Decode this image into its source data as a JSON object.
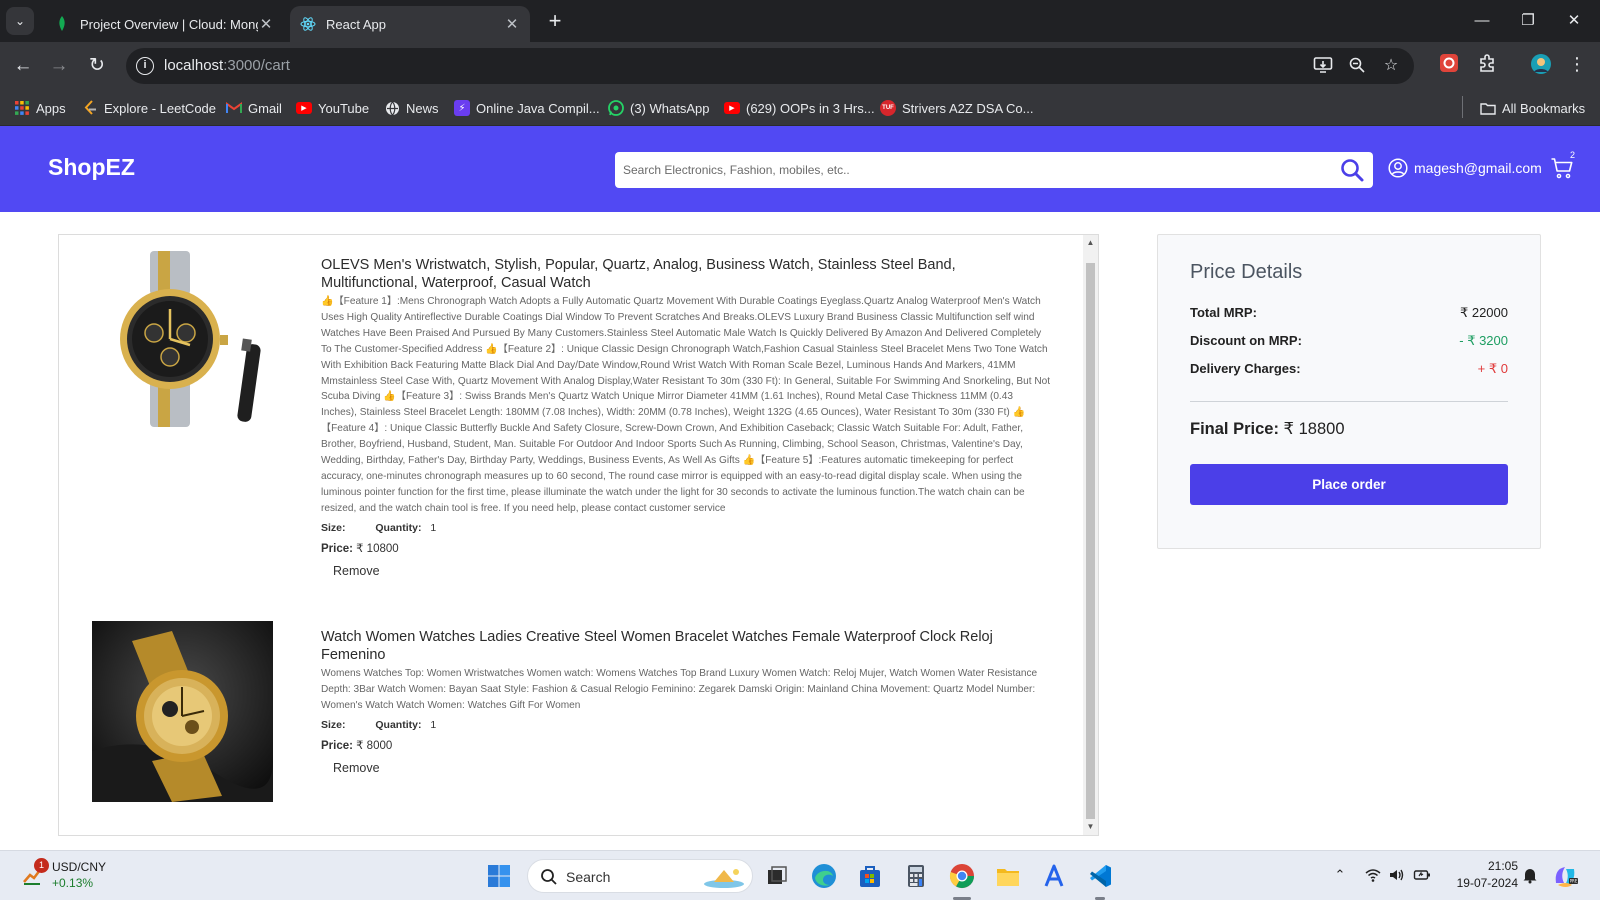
{
  "browser": {
    "tabs": [
      {
        "title": "Project Overview | Cloud: Mong",
        "active": false
      },
      {
        "title": "React App",
        "active": true
      }
    ],
    "url_host": "localhost",
    "url_path": ":3000/cart",
    "bookmarks": [
      {
        "label": "Apps",
        "icon": "apps-grid-icon"
      },
      {
        "label": "Explore - LeetCode",
        "icon": "leetcode-icon"
      },
      {
        "label": "Gmail",
        "icon": "gmail-icon"
      },
      {
        "label": "YouTube",
        "icon": "youtube-icon"
      },
      {
        "label": "News",
        "icon": "news-globe-icon"
      },
      {
        "label": "Online Java Compil...",
        "icon": "compiler-icon"
      },
      {
        "label": "(3) WhatsApp",
        "icon": "whatsapp-icon"
      },
      {
        "label": "(629) OOPs in 3 Hrs...",
        "icon": "youtube-icon"
      },
      {
        "label": "Strivers A2Z DSA Co...",
        "icon": "tuf-icon"
      }
    ],
    "all_bookmarks": "All Bookmarks"
  },
  "header": {
    "brand": "ShopEZ",
    "search_placeholder": "Search Electronics, Fashion, mobiles, etc..",
    "user_email": "magesh@gmail.com",
    "cart_count": "2",
    "colors": {
      "bar": "#5149f3"
    }
  },
  "cart": {
    "size_label": "Size:",
    "quantity_label": "Quantity:",
    "price_label": "Price:",
    "remove_label": "Remove",
    "items": [
      {
        "title": "OLEVS Men's Wristwatch, Stylish, Popular, Quartz, Analog, Business Watch, Stainless Steel Band, Multifunctional, Waterproof, Casual Watch",
        "description": "👍【Feature 1】:Mens Chronograph Watch Adopts a Fully Automatic Quartz Movement With Durable Coatings Eyeglass.Quartz Analog Waterproof Men's Watch Uses High Quality Antireflective Durable Coatings Dial Window To Prevent Scratches And Breaks.OLEVS Luxury Brand Business Classic Multifunction self wind Watches Have Been Praised And Pursued By Many Customers.Stainless Steel Automatic Male Watch Is Quickly Delivered By Amazon And Delivered Completely To The Customer-Specified Address 👍【Feature 2】: Unique Classic Design Chronograph Watch,Fashion Casual Stainless Steel Bracelet Mens Two Tone Watch With Exhibition Back Featuring Matte Black Dial And Day/Date Window,Round Wrist Watch With Roman Scale Bezel, Luminous Hands And Markers, 41MM Mmstainless Steel Case With, Quartz Movement With Analog Display,Water Resistant To 30m (330 Ft): In General, Suitable For Swimming And Snorkeling, But Not Scuba Diving 👍【Feature 3】: Swiss Brands Men's Quartz Watch Unique Mirror Diameter 41MM (1.61 Inches), Round Metal Case Thickness 11MM (0.43 Inches), Stainless Steel Bracelet Length: 180MM (7.08 Inches), Width: 20MM (0.78 Inches), Weight 132G (4.65 Ounces), Water Resistant To 30m (330 Ft) 👍【Feature 4】: Unique Classic Butterfly Buckle And Safety Closure, Screw-Down Crown, And Exhibition Caseback; Classic Watch Suitable For: Adult, Father, Brother, Boyfriend, Husband, Student, Man. Suitable For Outdoor And Indoor Sports Such As Running, Climbing, School Season, Christmas, Valentine's Day, Wedding, Birthday, Father's Day, Birthday Party, Weddings, Business Events, As Well As Gifts 👍【Feature 5】:Features automatic timekeeping for perfect accuracy, one-minutes chronograph measures up to 60 second, The round case mirror is equipped with an easy-to-read digital display scale. When using the luminous pointer function for the first time, please illuminate the watch under the light for 30 seconds to activate the luminous function.The watch chain can be resized, and the watch chain tool is free. If you need help, please contact customer service",
        "size": "",
        "quantity": "1",
        "price": "₹ 10800"
      },
      {
        "title": "Watch Women Watches Ladies Creative Steel Women Bracelet Watches Female Waterproof Clock Reloj Femenino",
        "description": "Womens Watches Top: Women Wristwatches Women watch: Womens Watches Top Brand Luxury Women Watch: Reloj Mujer, Watch Women Water Resistance Depth: 3Bar Watch Women: Bayan Saat Style: Fashion & Casual Relogio Feminino: Zegarek Damski Origin: Mainland China Movement: Quartz Model Number: Women's Watch Watch Women: Watches Gift For Women",
        "size": "",
        "quantity": "1",
        "price": "₹ 8000"
      }
    ]
  },
  "price_details": {
    "title": "Price Details",
    "total_mrp_label": "Total MRP:",
    "total_mrp": "₹ 22000",
    "discount_label": "Discount on MRP:",
    "discount": "- ₹ 3200",
    "delivery_label": "Delivery Charges:",
    "delivery": "+ ₹ 0",
    "final_label": "Final Price:",
    "final": "₹ 18800",
    "place_order": "Place order",
    "colors": {
      "discount": "#1e9e62",
      "delivery": "#e03a3a",
      "button": "#4b3fe8"
    }
  },
  "taskbar": {
    "stock_symbol": "USD/CNY",
    "stock_change": "+0.13%",
    "stock_badge": "1",
    "search_label": "Search",
    "time": "21:05",
    "date": "19-07-2024"
  }
}
